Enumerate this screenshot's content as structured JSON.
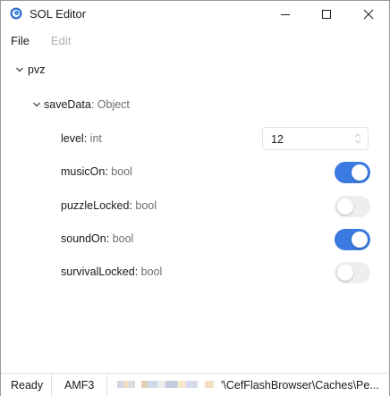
{
  "window": {
    "title": "SOL Editor",
    "icon": "app-globe-icon"
  },
  "menu": {
    "file": "File",
    "edit": "Edit"
  },
  "tree": {
    "root": {
      "name": "pvz"
    },
    "object": {
      "name": "saveData",
      "sep": ": ",
      "type": "Object"
    },
    "properties": [
      {
        "name": "level",
        "type": "int",
        "value": "12"
      },
      {
        "name": "musicOn",
        "type": "bool",
        "checked": true
      },
      {
        "name": "puzzleLocked",
        "type": "bool",
        "checked": false
      },
      {
        "name": "soundOn",
        "type": "bool",
        "checked": true
      },
      {
        "name": "survivalLocked",
        "type": "bool",
        "checked": false
      }
    ]
  },
  "status": {
    "state": "Ready",
    "format": "AMF3",
    "path": "'\\CefFlashBrowser\\Caches\\Pe..."
  },
  "colors": {
    "accent": "#3b7ae0",
    "toggle_off": "#eeeeee",
    "type_text": "#6d6d6d"
  }
}
